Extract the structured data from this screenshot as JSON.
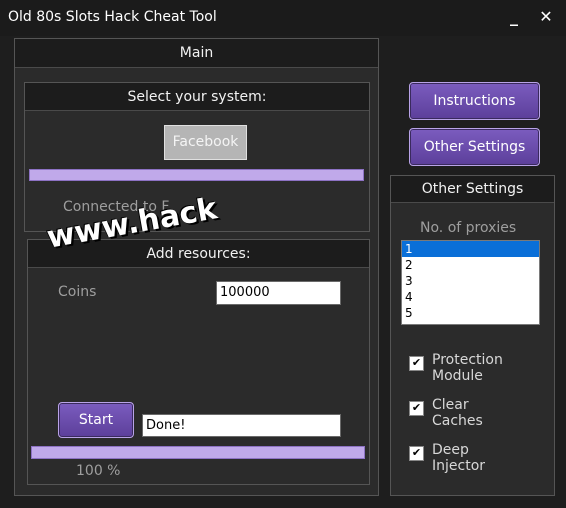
{
  "window": {
    "title": "Old 80s Slots Hack Cheat Tool",
    "minimize": "_",
    "close": "✕"
  },
  "main": {
    "header": "Main",
    "system": {
      "header": "Select your system:",
      "facebook_button": "Facebook",
      "progress_percent": 100,
      "status": "Connected to F"
    },
    "resources": {
      "header": "Add resources:",
      "coins_label": "Coins",
      "coins_value": "100000",
      "start_button": "Start",
      "status_value": "Done!",
      "progress_percent": 100,
      "progress_text": "100 %"
    }
  },
  "side": {
    "instructions_button": "Instructions",
    "other_settings_button": "Other Settings"
  },
  "other_settings": {
    "header": "Other Settings",
    "proxies_label": "No. of proxies",
    "proxies": [
      "1",
      "2",
      "3",
      "4",
      "5"
    ],
    "selected_proxy": "1",
    "checks": [
      {
        "label": "Protection Module",
        "checked": true
      },
      {
        "label": "Clear Caches",
        "checked": true
      },
      {
        "label": "Deep Injector",
        "checked": true
      }
    ]
  },
  "watermark": "www.hack"
}
